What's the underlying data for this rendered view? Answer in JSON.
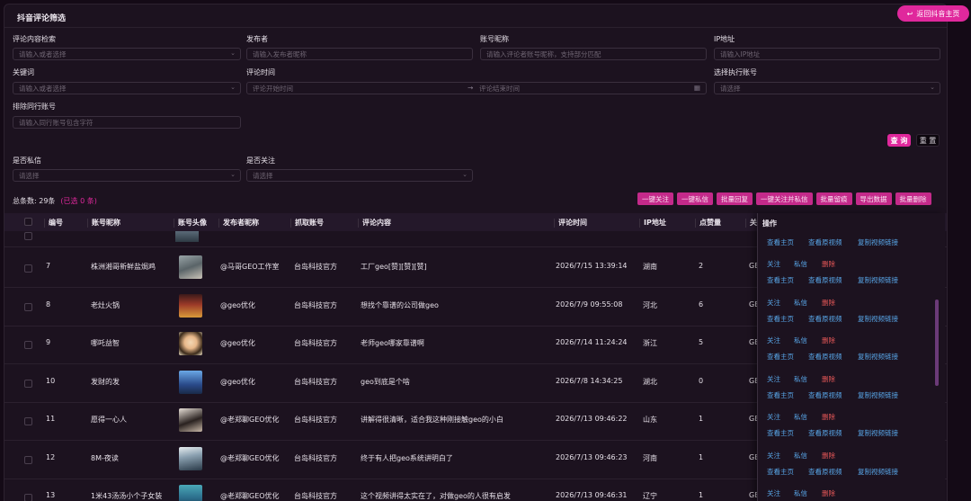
{
  "page": {
    "title": "抖音评论筛选",
    "back_button": "返回抖音主页"
  },
  "filters": {
    "content_search": {
      "label": "评论内容检索",
      "placeholder": "请输入或者选择"
    },
    "publisher": {
      "label": "发布者",
      "placeholder": "请输入发布者昵称"
    },
    "account_nick": {
      "label": "账号昵称",
      "placeholder": "请输入评论者账号昵称，支持部分匹配"
    },
    "ip": {
      "label": "IP地址",
      "placeholder": "请输入IP地址"
    },
    "keyword": {
      "label": "关键词",
      "placeholder": "请输入或者选择"
    },
    "comment_time": {
      "label": "评论时间",
      "start_placeholder": "评论开始时间",
      "end_placeholder": "评论结束时间"
    },
    "exec_account": {
      "label": "选择执行账号",
      "placeholder": "请选择"
    },
    "exclude_peer": {
      "label": "排除同行账号",
      "placeholder": "请输入同行账号包含字符"
    },
    "private_msg": {
      "label": "是否私信",
      "placeholder": "请选择"
    },
    "followed": {
      "label": "是否关注",
      "placeholder": "请选择"
    },
    "query_button": "查 询",
    "reset_button": "重 置"
  },
  "summary": {
    "total": "总条数: 29条",
    "selected": "(已选 0 条)"
  },
  "bulk_actions": [
    "一键关注",
    "一键私信",
    "批量回复",
    "一键关注并私信",
    "批量留痕",
    "导出数据",
    "批量删除"
  ],
  "table": {
    "headers": {
      "num": "编号",
      "nick": "账号昵称",
      "avatar": "账号头像",
      "publisher": "发布者昵称",
      "crawl": "抓取账号",
      "content": "评论内容",
      "time": "评论时间",
      "ip": "IP地址",
      "likes": "点赞量",
      "extra": "关",
      "ops": "操作"
    },
    "rows": [
      {
        "num": "7",
        "nick": "株洲湘哥新鲜盐焗鸡",
        "publisher": "@马哥GEO工作室",
        "crawl": "台岛科技官方",
        "content": "工厂geo[赞][赞][赞]",
        "time": "2026/7/15 13:39:14",
        "ip": "湖南",
        "likes": "2",
        "extra": "GE"
      },
      {
        "num": "8",
        "nick": "老灶火锅",
        "publisher": "@geo优化",
        "crawl": "台岛科技官方",
        "content": "想找个靠谱的公司做geo",
        "time": "2026/7/9 09:55:08",
        "ip": "河北",
        "likes": "6",
        "extra": "GE"
      },
      {
        "num": "9",
        "nick": "哪吒益智",
        "publisher": "@geo优化",
        "crawl": "台岛科技官方",
        "content": "老师geo哪家靠谱啊",
        "time": "2026/7/14 11:24:24",
        "ip": "浙江",
        "likes": "5",
        "extra": "GE"
      },
      {
        "num": "10",
        "nick": "发财的发",
        "publisher": "@geo优化",
        "crawl": "台岛科技官方",
        "content": "geo到底是个啥",
        "time": "2026/7/8 14:34:25",
        "ip": "湖北",
        "likes": "0",
        "extra": "GE"
      },
      {
        "num": "11",
        "nick": "愿得一心人",
        "publisher": "@老郑聊GEO优化",
        "crawl": "台岛科技官方",
        "content": "讲解得很清晰，适合我这种刚接触geo的小白",
        "time": "2026/7/13 09:46:22",
        "ip": "山东",
        "likes": "1",
        "extra": "GE"
      },
      {
        "num": "12",
        "nick": "8M-夜读",
        "publisher": "@老郑聊GEO优化",
        "crawl": "台岛科技官方",
        "content": "终于有人把geo系统讲明白了",
        "time": "2026/7/13 09:46:23",
        "ip": "河南",
        "likes": "1",
        "extra": "GE"
      },
      {
        "num": "13",
        "nick": "1米43汤汤小个子女装",
        "publisher": "@老郑聊GEO优化",
        "crawl": "台岛科技官方",
        "content": "这个视频讲得太实在了，对做geo的人很有启发",
        "time": "2026/7/13 09:46:31",
        "ip": "辽宁",
        "likes": "1",
        "extra": "GE"
      }
    ]
  },
  "ops": {
    "view_home": "查看主页",
    "view_video": "查看原视频",
    "copy_link": "复制视频链接",
    "follow": "关注",
    "message": "私信",
    "delete": "删除"
  },
  "colors": {
    "accent": "#e0289c",
    "link": "#58a6e8",
    "danger": "#e85858",
    "background": "#1c121f"
  }
}
